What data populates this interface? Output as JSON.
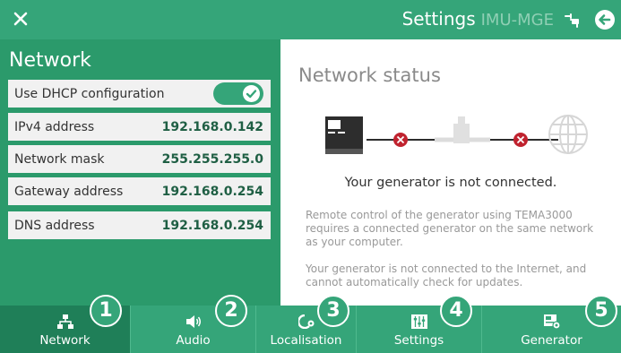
{
  "header": {
    "close_icon": "close-icon",
    "title": "Settings",
    "device": "IMU-MGE",
    "plug_icon": "plug-icon",
    "back_icon": "back-arrow-icon"
  },
  "network": {
    "section_title": "Network",
    "dhcp_label": "Use DHCP configuration",
    "dhcp_enabled": true,
    "rows": [
      {
        "label": "IPv4 address",
        "value": "192.168.0.142"
      },
      {
        "label": "Network mask",
        "value": "255.255.255.0"
      },
      {
        "label": "Gateway address",
        "value": "192.168.0.254"
      },
      {
        "label": "DNS address",
        "value": "192.168.0.254"
      }
    ]
  },
  "status": {
    "title": "Network status",
    "message": "Your generator is not connected.",
    "info1_lines": [
      "Remote control of the generator using TEMA3000",
      "requires a connected generator on the same network",
      "as your computer."
    ],
    "info2_lines": [
      "Your generator is not connected to the Internet, and",
      "cannot automatically check for updates."
    ]
  },
  "tabs": [
    {
      "label": "Network",
      "badge": "1",
      "icon": "network-icon",
      "active": true
    },
    {
      "label": "Audio",
      "badge": "2",
      "icon": "speaker-icon",
      "active": false
    },
    {
      "label": "Localisation",
      "badge": "3",
      "icon": "localisation-icon",
      "active": false
    },
    {
      "label": "Settings",
      "badge": "4",
      "icon": "sliders-icon",
      "active": false
    },
    {
      "label": "Generator",
      "badge": "5",
      "icon": "generator-icon",
      "active": false
    }
  ],
  "colors": {
    "primary": "#35a579",
    "panel": "#2b9a6b",
    "active_tab": "#1f7f58",
    "error": "#c0232f"
  }
}
